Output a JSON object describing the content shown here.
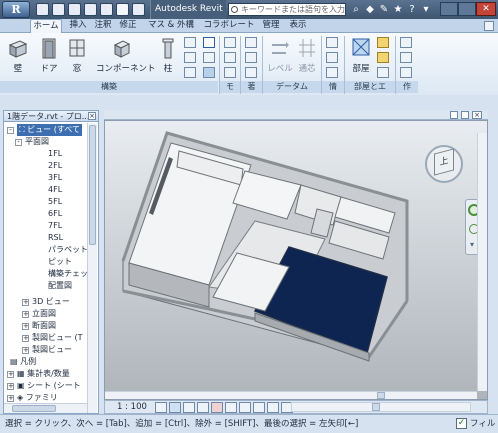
{
  "titlebar": {
    "app_button": "R",
    "app_title": "Autodesk Revit ...",
    "search_placeholder": "キーワードまたは語句を入力"
  },
  "tabs": [
    {
      "label": "ホーム",
      "active": true
    },
    {
      "label": "挿入"
    },
    {
      "label": "注釈"
    },
    {
      "label": "修正"
    },
    {
      "label": "マス & 外構"
    },
    {
      "label": "コラボレート"
    },
    {
      "label": "管理"
    },
    {
      "label": "表示"
    }
  ],
  "ribbon": {
    "buttons": {
      "wall": "壁",
      "door": "ドア",
      "window": "窓",
      "component": "コンポーネント",
      "column": "柱",
      "level": "レベル",
      "grid": "通芯",
      "room": "部屋"
    },
    "groups": {
      "build": "構築",
      "model": "モ",
      "text": "著",
      "datum": "データム",
      "work": "情",
      "room_area": "部屋とエ",
      "work2": "作"
    }
  },
  "project_browser": {
    "title": "1階データ.rvt - プロ...",
    "root": "ビュー (すべて",
    "floor_plans": "平面図",
    "levels": [
      "1FL",
      "2FL",
      "3FL",
      "4FL",
      "5FL",
      "6FL",
      "7FL",
      "RSL",
      "パラペット",
      "ピット",
      "構築チェッ",
      "配置図"
    ],
    "items": [
      {
        "label": "3D ビュー",
        "level": 2
      },
      {
        "label": "立面図",
        "level": 2
      },
      {
        "label": "断面図",
        "level": 2
      },
      {
        "label": "製図ビュー (T",
        "level": 2
      },
      {
        "label": "製図ビュー",
        "level": 2
      },
      {
        "label": "凡例",
        "level": 1
      },
      {
        "label": "集計表/数量",
        "level": 1
      },
      {
        "label": "シート (シート",
        "level": 1
      },
      {
        "label": "ファミリ",
        "level": 1
      }
    ]
  },
  "view": {
    "scale": "1 : 100",
    "viewcube_label": "上"
  },
  "statusbar": {
    "text": "選択 = クリック、次へ = [Tab]、追加 = [Ctrl]、除外 = [SHIFT]、最後の選択 = 左矢印[←]",
    "filter_label": "フィルタ"
  },
  "colors": {
    "selected_room": "#0e2552",
    "titlebar": "#485f7c",
    "ribbon_accent": "#2c5fa8"
  }
}
